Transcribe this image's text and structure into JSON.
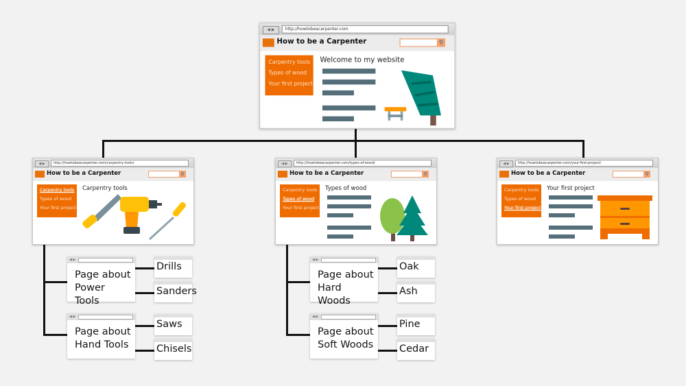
{
  "site_title": "How to be a Carpenter",
  "nav_items": [
    "Carpentry tools",
    "Types of wood",
    "Your first project"
  ],
  "nav_arrows": "◀ ▶",
  "search_icon": "magnifier-icon",
  "colors": {
    "accent": "#ef6c00",
    "lines": "#546e7a",
    "tree": "#00897b",
    "connector": "#111111"
  },
  "home": {
    "url": "http://howtobeacarpenter.com",
    "heading": "Welcome to my website"
  },
  "pages": [
    {
      "url": "http://howtobeacarpenter.com/carpentry-tools/",
      "heading": "Carpentry tools"
    },
    {
      "url": "http://howtobeacarpenter.com/types-of-wood/",
      "heading": "Types of wood"
    },
    {
      "url": "http://howtobeacarpenter.com/your-first-project/",
      "heading": "Your first project"
    }
  ],
  "subpages": {
    "tools": [
      {
        "title": "Page about Power Tools",
        "children": [
          "Drills",
          "Sanders"
        ]
      },
      {
        "title": "Page about Hand Tools",
        "children": [
          "Saws",
          "Chisels"
        ]
      }
    ],
    "wood": [
      {
        "title": "Page about Hard Woods",
        "children": [
          "Oak",
          "Ash"
        ]
      },
      {
        "title": "Page about Soft Woods",
        "children": [
          "Pine",
          "Cedar"
        ]
      }
    ]
  }
}
